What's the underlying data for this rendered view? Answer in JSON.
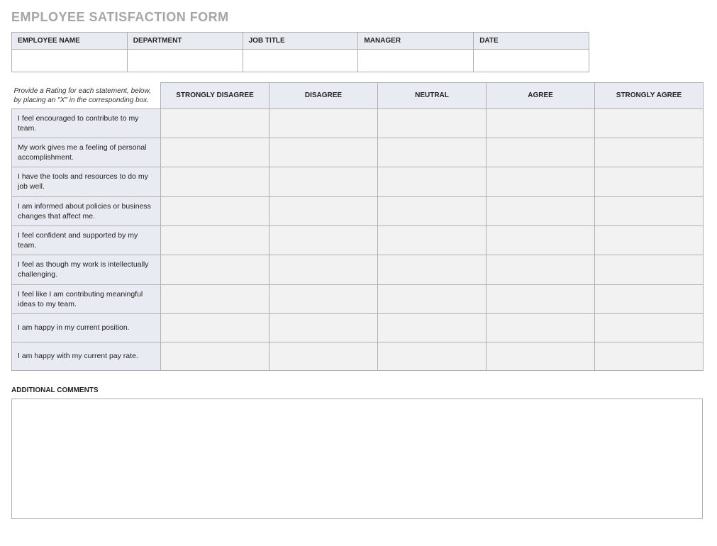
{
  "title": "EMPLOYEE SATISFACTION FORM",
  "info_headers": [
    "EMPLOYEE NAME",
    "DEPARTMENT",
    "JOB TITLE",
    "MANAGER",
    "DATE"
  ],
  "info_values": [
    "",
    "",
    "",
    "",
    ""
  ],
  "instruction": "Provide a Rating for each statement, below, by placing an \"X\" in the corresponding box.",
  "scale": [
    "STRONGLY DISAGREE",
    "DISAGREE",
    "NEUTRAL",
    "AGREE",
    "STRONGLY AGREE"
  ],
  "statements": [
    "I feel encouraged to contribute to my team.",
    "My work gives me a feeling of personal accomplishment.",
    "I have the tools and resources to do my job well.",
    "I am informed about policies or business changes that affect me.",
    "I feel confident and supported by my team.",
    "I feel as though my work is intellectually challenging.",
    "I feel like I am contributing meaningful ideas to my team.",
    "I am happy in my current position.",
    "I am happy with my current pay rate."
  ],
  "comments_label": "ADDITIONAL COMMENTS",
  "comments_value": ""
}
